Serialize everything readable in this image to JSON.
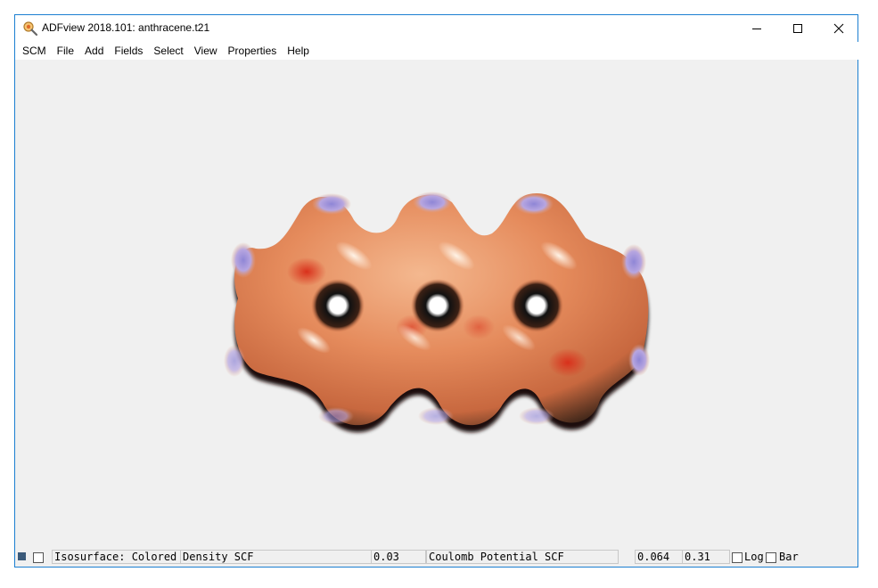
{
  "window": {
    "title": "ADFview 2018.101: anthracene.t21"
  },
  "menu": {
    "items": [
      "SCM",
      "File",
      "Add",
      "Fields",
      "Select",
      "View",
      "Properties",
      "Help"
    ]
  },
  "status_bar": {
    "isosurface_label": "Isosurface: Colored",
    "field": "Density SCF",
    "iso_value": "0.03",
    "color_field": "Coulomb Potential SCF",
    "range_min": "0.064",
    "range_max": "0.31",
    "log_label": "Log",
    "bar_label": "Bar",
    "log_checked": false,
    "bar_checked": false
  },
  "colors": {
    "window_border": "#1b7fd1",
    "background": "#f0f0f0",
    "surface_main": "#e38a5a",
    "surface_highlight": "#f6c9a0",
    "surface_red": "#d9301b",
    "surface_blue": "#8f86d6"
  },
  "icons": {
    "app": "magnifier-molecule-icon",
    "minimize": "minimize-icon",
    "maximize": "maximize-icon",
    "close": "close-icon"
  }
}
